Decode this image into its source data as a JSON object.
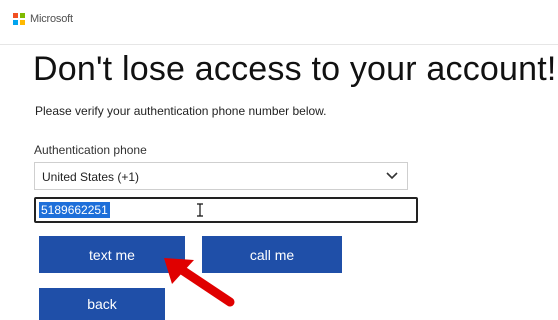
{
  "header": {
    "brand": "Microsoft",
    "logo_colors": [
      "#f25022",
      "#7fba00",
      "#00a4ef",
      "#ffb900"
    ]
  },
  "page": {
    "title": "Don't lose access to your account!",
    "subtitle": "Please verify your authentication phone number below."
  },
  "form": {
    "phone_label": "Authentication phone",
    "country_value": "United States (+1)",
    "phone_value": "5189662251"
  },
  "buttons": {
    "text_me": "text me",
    "call_me": "call me",
    "back": "back"
  },
  "annotation": {
    "arrow_color": "#e00000",
    "arrow_icon": "red-arrow-icon"
  },
  "colors": {
    "button": "#1f4fa8",
    "selection": "#1e6fd9"
  }
}
